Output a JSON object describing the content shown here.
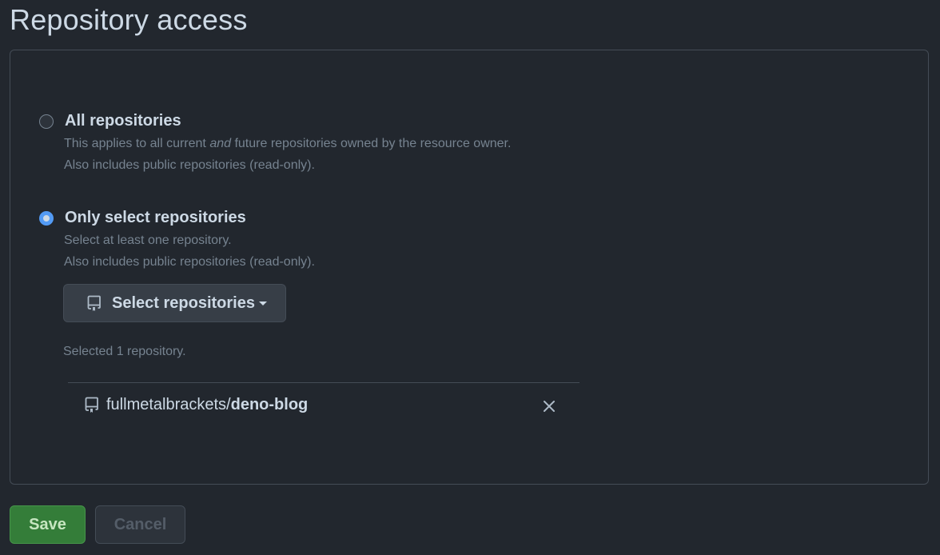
{
  "page": {
    "title": "Repository access"
  },
  "options": {
    "all": {
      "label": "All repositories",
      "desc_pre": "This applies to all current ",
      "desc_em": "and",
      "desc_post": " future repositories owned by the resource owner.",
      "desc_line2": "Also includes public repositories (read-only).",
      "checked": false
    },
    "select": {
      "label": "Only select repositories",
      "desc_line1": "Select at least one repository.",
      "desc_line2": "Also includes public repositories (read-only).",
      "checked": true
    }
  },
  "select_button": {
    "label": "Select repositories",
    "icon": "repo-icon"
  },
  "selection": {
    "count_text": "Selected 1 repository.",
    "repos": [
      {
        "owner": "fullmetalbrackets/",
        "name": "deno-blog",
        "icon": "repo-icon",
        "remove_icon": "close-icon"
      }
    ]
  },
  "actions": {
    "save_label": "Save",
    "cancel_label": "Cancel"
  },
  "colors": {
    "background": "#22272e",
    "accent": "#539bf5",
    "save_button": "#347d39",
    "border": "#444c56"
  }
}
